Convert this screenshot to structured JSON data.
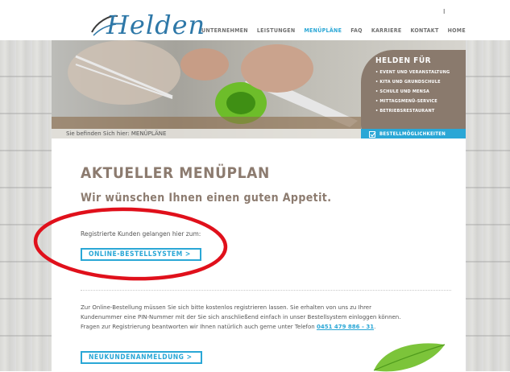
{
  "header": {
    "logo_text": "Helden",
    "top_marker": "I",
    "nav": [
      "UNTERNEHMEN",
      "LEISTUNGEN",
      "MENÜPLÄNE",
      "FAQ",
      "KARRIERE",
      "KONTAKT",
      "HOME"
    ],
    "nav_active": "MENÜPLÄNE"
  },
  "hero": {
    "breadcrumb": "Sie befinden Sich hier: MENÜPLÄNE",
    "box_title": "HELDEN FÜR",
    "box_items": [
      "EVENT UND VERANSTALTUNG",
      "KITA UND GRUNDSCHULE",
      "SCHULE UND MENSA",
      "MITTAGSMENÜ-SERVICE",
      "BETRIEBSRESTAURANT"
    ],
    "bestell_label": "BESTELLMÖGLICHKEITEN"
  },
  "main": {
    "title": "AKTUELLER MENÜPLAN",
    "subtitle": "Wir wünschen Ihnen einen guten Appetit.",
    "registered_text": "Registrierte Kunden gelangen hier zum:",
    "online_button": "ONLINE-BESTELLSYSTEM  >",
    "info_line1": "Zur Online-Bestellung müssen Sie sich bitte kostenlos registrieren lassen. Sie erhalten von uns zu Ihrer",
    "info_line2": "Kundenummer eine PIN-Nummer mit der Sie sich anschließend einfach in unser Bestellsystem einloggen können.",
    "info_line3_prefix": "Fragen zur Registrierung beantworten wir Ihnen natürlich auch gerne unter Telefon ",
    "phone": "0451  479 886 - 31",
    "info_line3_suffix": ".",
    "new_customer_button": "NEUKUNDENANMELDUNG  >"
  },
  "colors": {
    "accent": "#2aa7d6",
    "brand_brown": "#8c7b6f",
    "box_brown": "#8a7a6d",
    "annotation_red": "#e0101b"
  }
}
